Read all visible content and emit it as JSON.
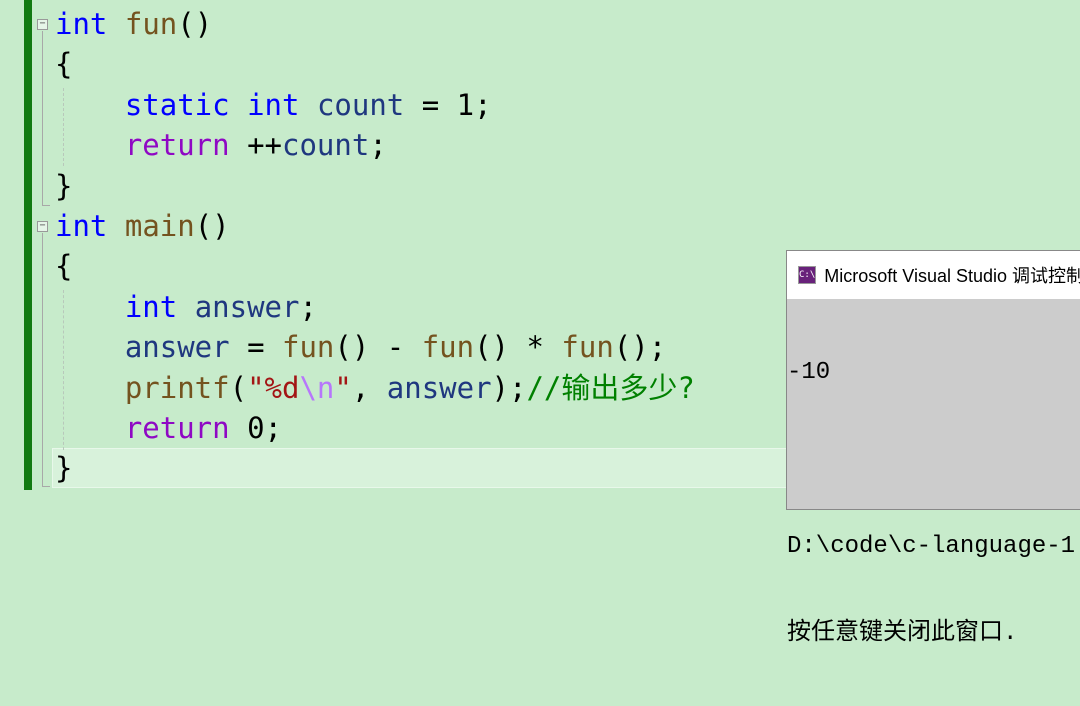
{
  "editor": {
    "lines": [
      [
        {
          "t": "int",
          "c": "kw"
        },
        {
          "t": " "
        },
        {
          "t": "fun",
          "c": "fn"
        },
        {
          "t": "()"
        }
      ],
      [
        {
          "t": "{"
        }
      ],
      [
        {
          "t": "    "
        },
        {
          "t": "static",
          "c": "kw"
        },
        {
          "t": " "
        },
        {
          "t": "int",
          "c": "kw"
        },
        {
          "t": " "
        },
        {
          "t": "count",
          "c": "var"
        },
        {
          "t": " = 1;"
        }
      ],
      [
        {
          "t": "    "
        },
        {
          "t": "return",
          "c": "ctl"
        },
        {
          "t": " ++"
        },
        {
          "t": "count",
          "c": "var"
        },
        {
          "t": ";"
        }
      ],
      [
        {
          "t": "}"
        }
      ],
      [
        {
          "t": "int",
          "c": "kw"
        },
        {
          "t": " "
        },
        {
          "t": "main",
          "c": "fn"
        },
        {
          "t": "()"
        }
      ],
      [
        {
          "t": "{"
        }
      ],
      [
        {
          "t": "    "
        },
        {
          "t": "int",
          "c": "kw"
        },
        {
          "t": " "
        },
        {
          "t": "answer",
          "c": "var"
        },
        {
          "t": ";"
        }
      ],
      [
        {
          "t": "    "
        },
        {
          "t": "answer",
          "c": "var"
        },
        {
          "t": " = "
        },
        {
          "t": "fun",
          "c": "fn"
        },
        {
          "t": "() - "
        },
        {
          "t": "fun",
          "c": "fn"
        },
        {
          "t": "() * "
        },
        {
          "t": "fun",
          "c": "fn"
        },
        {
          "t": "();"
        }
      ],
      [
        {
          "t": "    "
        },
        {
          "t": "printf",
          "c": "fn"
        },
        {
          "t": "("
        },
        {
          "t": "\"%d",
          "c": "str"
        },
        {
          "t": "\\n",
          "c": "esc"
        },
        {
          "t": "\"",
          "c": "str"
        },
        {
          "t": ", "
        },
        {
          "t": "answer",
          "c": "var"
        },
        {
          "t": ");"
        },
        {
          "t": "//输出多少?",
          "c": "cmt"
        }
      ],
      [
        {
          "t": "    "
        },
        {
          "t": "return",
          "c": "ctl"
        },
        {
          "t": " 0;"
        }
      ],
      [
        {
          "t": "}"
        }
      ]
    ]
  },
  "console": {
    "icon": "C:\\",
    "title": "Microsoft Visual Studio 调试控制台",
    "output": [
      "-10",
      "",
      "D:\\code\\c-language-1",
      "按任意键关闭此窗口."
    ]
  },
  "colors": {
    "background": "#c7ebcb",
    "gutter": "#127a12",
    "keyword": "#0000ff",
    "function": "#74531f",
    "control": "#8f08c4",
    "variable": "#1f377f",
    "string": "#a31515",
    "comment": "#008000",
    "console_bg": "#cccccc"
  }
}
